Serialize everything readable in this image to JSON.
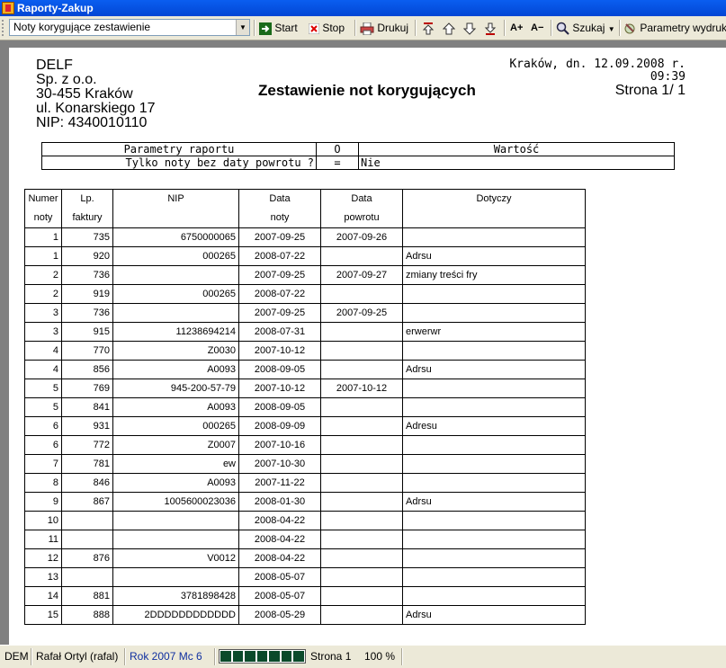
{
  "window": {
    "title": "Raporty-Zakup"
  },
  "toolbar": {
    "report_select": "Noty korygujące zestawienie",
    "start": "Start",
    "stop": "Stop",
    "print": "Drukuj",
    "zoom_in": "A+",
    "zoom_out": "A−",
    "search": "Szukaj",
    "params": "Parametry wydruku"
  },
  "report": {
    "company": [
      "DELF",
      "Sp. z o.o.",
      "30-455 Kraków",
      "ul. Konarskiego 17",
      "NIP:  4340010110"
    ],
    "title": "Zestawienie not korygujących",
    "date_line": "Kraków, dn. 12.09.2008 r.",
    "time": "09:39",
    "page": "Strona 1/ 1",
    "params_table": {
      "headers": [
        "Parametry raportu",
        "O",
        "Wartość"
      ],
      "row": [
        "Tylko noty bez daty powrotu ?",
        "=",
        "Nie"
      ]
    },
    "columns": [
      [
        "Numer",
        "noty"
      ],
      [
        "Lp.",
        "faktury"
      ],
      [
        "NIP",
        ""
      ],
      [
        "Data",
        "noty"
      ],
      [
        "Data",
        "powrotu"
      ],
      [
        "Dotyczy",
        ""
      ]
    ],
    "rows": [
      [
        "1",
        "735",
        "6750000065",
        "2007-09-25",
        "2007-09-26",
        ""
      ],
      [
        "1",
        "920",
        "000265",
        "2008-07-22",
        "",
        "Adrsu"
      ],
      [
        "2",
        "736",
        "",
        "2007-09-25",
        "2007-09-27",
        "zmiany treści fry"
      ],
      [
        "2",
        "919",
        "000265",
        "2008-07-22",
        "",
        ""
      ],
      [
        "3",
        "736",
        "",
        "2007-09-25",
        "2007-09-25",
        ""
      ],
      [
        "3",
        "915",
        "11238694214",
        "2008-07-31",
        "",
        "erwerwr"
      ],
      [
        "4",
        "770",
        "Z0030",
        "2007-10-12",
        "",
        ""
      ],
      [
        "4",
        "856",
        "A0093",
        "2008-09-05",
        "",
        "Adrsu"
      ],
      [
        "5",
        "769",
        "945-200-57-79",
        "2007-10-12",
        "2007-10-12",
        ""
      ],
      [
        "5",
        "841",
        "A0093",
        "2008-09-05",
        "",
        ""
      ],
      [
        "6",
        "931",
        "000265",
        "2008-09-09",
        "",
        "Adresu"
      ],
      [
        "6",
        "772",
        "Z0007",
        "2007-10-16",
        "",
        ""
      ],
      [
        "7",
        "781",
        "ew",
        "2007-10-30",
        "",
        ""
      ],
      [
        "8",
        "846",
        "A0093",
        "2007-11-22",
        "",
        ""
      ],
      [
        "9",
        "867",
        "1005600023036",
        "2008-01-30",
        "",
        "Adrsu"
      ],
      [
        "10",
        "",
        "",
        "2008-04-22",
        "",
        ""
      ],
      [
        "11",
        "",
        "",
        "2008-04-22",
        "",
        ""
      ],
      [
        "12",
        "876",
        "V0012",
        "2008-04-22",
        "",
        ""
      ],
      [
        "13",
        "",
        "",
        "2008-05-07",
        "",
        ""
      ],
      [
        "14",
        "881",
        "3781898428",
        "2008-05-07",
        "",
        ""
      ],
      [
        "15",
        "888",
        "2DDDDDDDDDDDD",
        "2008-05-29",
        "",
        "Adrsu"
      ]
    ]
  },
  "status": {
    "db": "DEM",
    "user": "Rafał Ortyl (rafal)",
    "period": "Rok 2007  Mc 6",
    "progress_segments": 7,
    "page": "Strona 1",
    "zoom": "100 %"
  }
}
